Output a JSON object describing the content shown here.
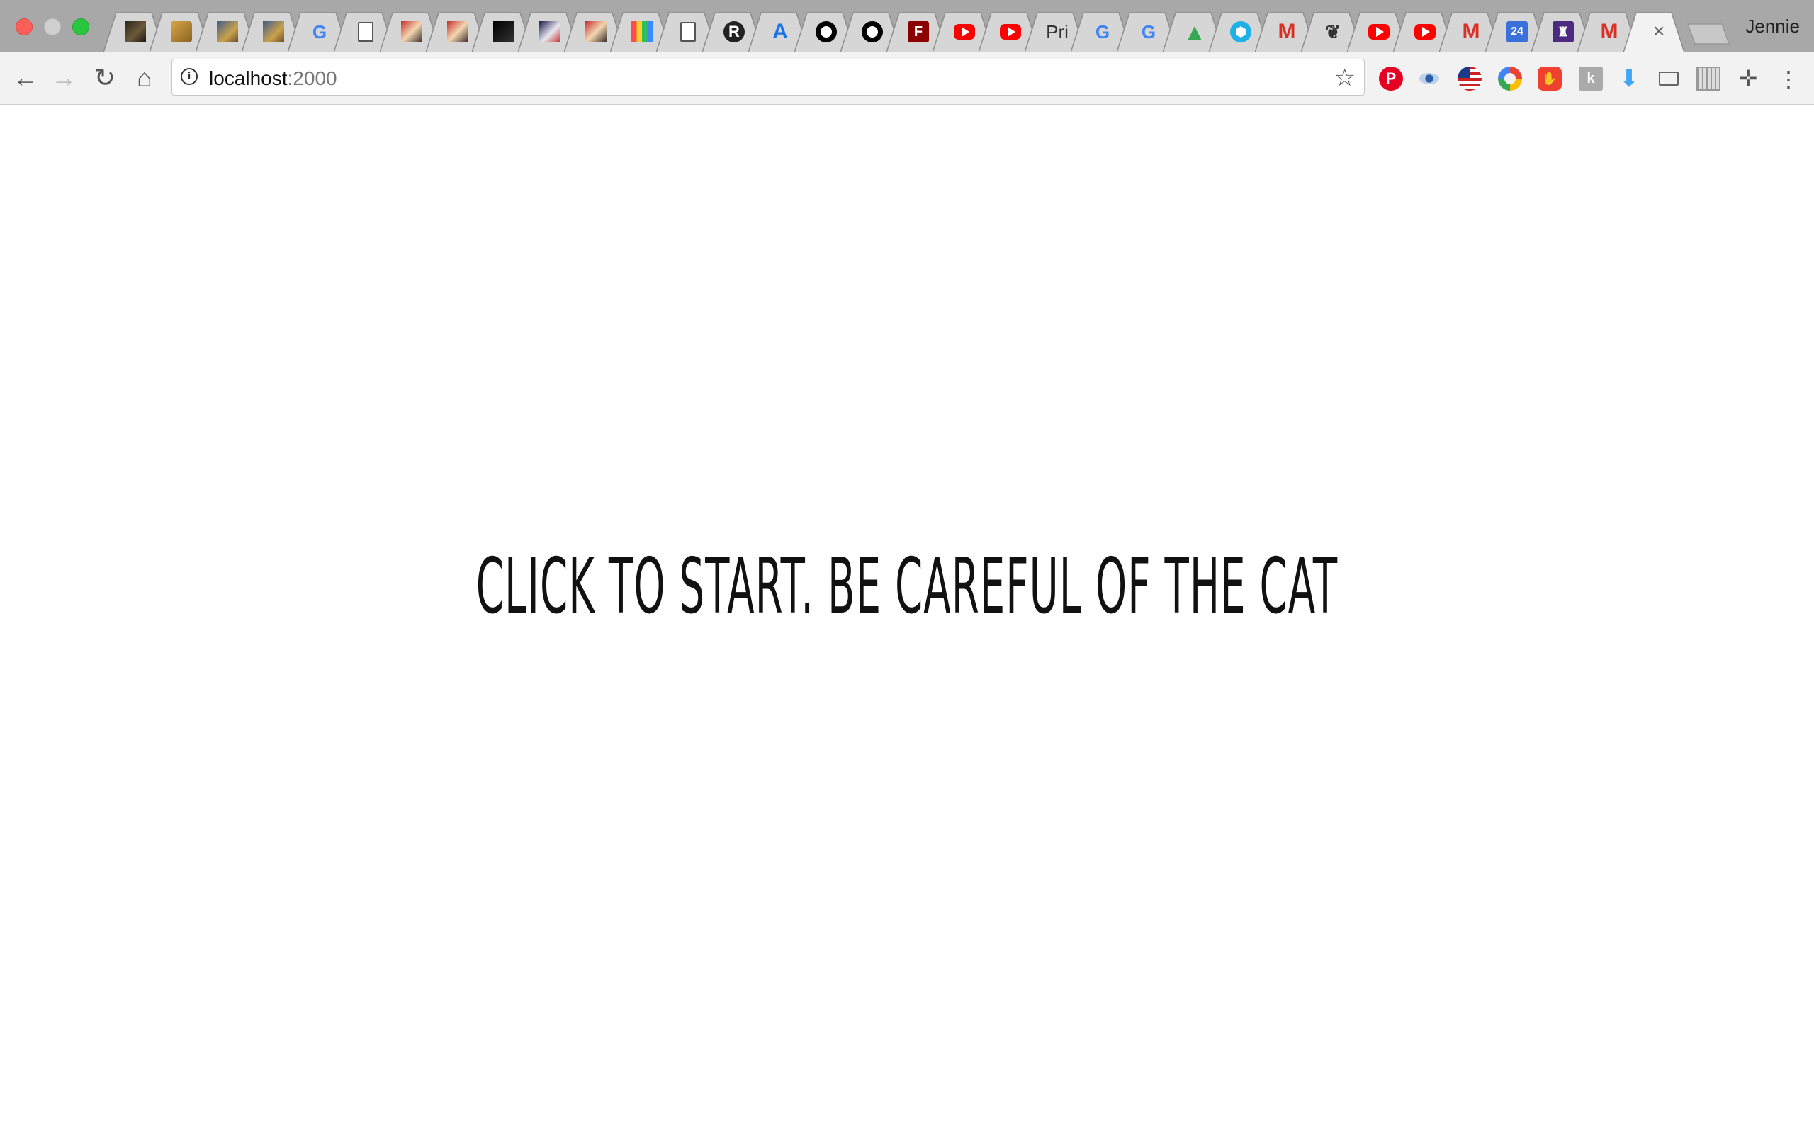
{
  "window": {
    "controls": [
      "close",
      "minimize",
      "maximize"
    ],
    "profile_name": "Jennie"
  },
  "tabs": [
    {
      "icon": "image-thumb-dark"
    },
    {
      "icon": "image-thumb-gold"
    },
    {
      "icon": "image-thumb-painting"
    },
    {
      "icon": "image-thumb-painting"
    },
    {
      "icon": "google-icon",
      "glyph": "G"
    },
    {
      "icon": "document-icon"
    },
    {
      "icon": "image-thumb-red"
    },
    {
      "icon": "image-thumb-red"
    },
    {
      "icon": "image-thumb-black"
    },
    {
      "icon": "image-thumb-figure"
    },
    {
      "icon": "image-thumb-red"
    },
    {
      "icon": "image-thumb-colorful"
    },
    {
      "icon": "document-icon"
    },
    {
      "icon": "r-circle-icon",
      "glyph": "R"
    },
    {
      "icon": "a-app-icon",
      "glyph": "A"
    },
    {
      "icon": "github-icon"
    },
    {
      "icon": "github-icon"
    },
    {
      "icon": "f-app-icon",
      "glyph": "F"
    },
    {
      "icon": "youtube-icon"
    },
    {
      "icon": "youtube-icon"
    },
    {
      "icon": "text-favicon",
      "glyph": "Pri"
    },
    {
      "icon": "google-icon",
      "glyph": "G"
    },
    {
      "icon": "google-icon",
      "glyph": "G"
    },
    {
      "icon": "google-drive-icon",
      "glyph": "▲"
    },
    {
      "icon": "cube-icon",
      "glyph": "⬢"
    },
    {
      "icon": "gmail-icon",
      "glyph": "M"
    },
    {
      "icon": "laurel-icon",
      "glyph": "❦"
    },
    {
      "icon": "youtube-icon"
    },
    {
      "icon": "youtube-icon"
    },
    {
      "icon": "gmail-icon",
      "glyph": "M"
    },
    {
      "icon": "calendar-icon",
      "glyph": "24"
    },
    {
      "icon": "purple-app-icon",
      "glyph": "♜"
    },
    {
      "icon": "gmail-icon",
      "glyph": "M"
    },
    {
      "icon": "active-tab",
      "close_glyph": "×"
    }
  ],
  "toolbar": {
    "back_glyph": "←",
    "forward_glyph": "→",
    "reload_glyph": "↻",
    "home_glyph": "⌂",
    "url_host": "localhost",
    "url_port": ":2000",
    "star_glyph": "☆",
    "extensions": [
      "pinterest-icon",
      "eye-icon",
      "flag-icon",
      "ring-icon",
      "stop-icon",
      "k-icon",
      "download-icon",
      "cast-icon",
      "grid-icon",
      "move-icon"
    ],
    "menu_glyph": "⋮"
  },
  "page": {
    "message": "CLICK TO START. BE CAREFUL OF THE CAT"
  },
  "colors": {
    "tabstrip_bg": "#a8a8a8",
    "tab_bg": "#d6d6d6",
    "active_tab_bg": "#f2f2f2",
    "toolbar_bg": "#f2f2f2",
    "page_bg": "#ffffff",
    "text": "#111111"
  }
}
